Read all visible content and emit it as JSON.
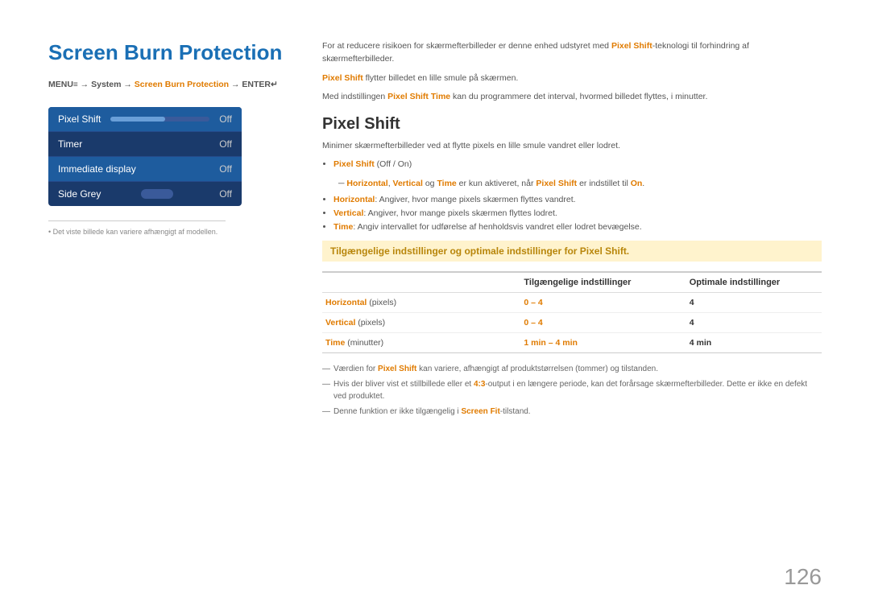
{
  "page": {
    "title": "Screen Burn Protection",
    "page_number": "126",
    "menu_path": {
      "prefix": "MENU",
      "menu_symbol": "≡",
      "path1": " → System → ",
      "highlight": "Screen Burn Protection",
      "path2": " → ENTER"
    },
    "intro": {
      "line1": "For at reducere risikoen for skærmefterbilleder er denne enhed udstyret med ",
      "bold1": "Pixel Shift",
      "line1b": "-teknologi til forhindring af skærmefterbilleder.",
      "line2_bold": "Pixel Shift",
      "line2": " flytter billedet en lille smule på skærmen.",
      "line3": "Med indstillingen ",
      "line3_bold": "Pixel Shift Time",
      "line3b": " kan du programmere det interval, hvormed billedet flyttes, i minutter."
    },
    "pixel_shift_section": {
      "title": "Pixel Shift",
      "body": "Minimer skærmefterbilleder ved at flytte pixels en lille smule vandret eller lodret.",
      "bullets": [
        {
          "text_bold": "Pixel Shift",
          "text": " (Off / On)"
        }
      ],
      "sub_note": "Horizontal, Vertical og Time er kun aktiveret, når Pixel Shift er indstillet til On.",
      "bullets2": [
        {
          "bold": "Horizontal",
          "text": ": Angiver, hvor mange pixels skærmen flyttes vandret."
        },
        {
          "bold": "Vertical",
          "text": ": Angiver, hvor mange pixels skærmen flyttes lodret."
        },
        {
          "bold": "Time",
          "text": ": Angiv intervallet for udførelse af henholdsvis vandret eller lodret bevægelse."
        }
      ]
    },
    "highlight_text": "Tilgængelige indstillinger og optimale indstillinger for Pixel Shift.",
    "table": {
      "headers": [
        "",
        "Tilgængelige indstillinger",
        "Optimale indstillinger"
      ],
      "rows": [
        {
          "label_bold": "Horizontal",
          "label_rest": " (pixels)",
          "col2": "0 – 4",
          "col3": "4"
        },
        {
          "label_bold": "Vertical",
          "label_rest": " (pixels)",
          "col2": "0 – 4",
          "col3": "4"
        },
        {
          "label_bold": "Time",
          "label_rest": " (minutter)",
          "col2": "1 min – 4 min",
          "col3": "4 min"
        }
      ]
    },
    "footnotes": [
      {
        "bold": "Pixel Shift",
        "text": " kan variere, afhængigt af produktstørrelsen (tommer) og tilstanden."
      },
      {
        "text": "Hvis der bliver vist et stillbillede eller et ",
        "bold": "4:3",
        "text2": "-output i en længere periode, kan det forårsage skærmefterbilleder. Dette er ikke en defekt ved produktet."
      },
      {
        "text": "Denne funktion er ikke tilgængelig i ",
        "bold": "Screen Fit",
        "text2": "-tilstand."
      }
    ],
    "menu_items": [
      {
        "label": "Pixel Shift",
        "type": "slider",
        "value": "Off"
      },
      {
        "label": "Timer",
        "type": "value",
        "value": "Off"
      },
      {
        "label": "Immediate display",
        "type": "value",
        "value": "Off"
      },
      {
        "label": "Side Grey",
        "type": "slider_small",
        "value": "Off"
      }
    ],
    "image_note": "Det viste billede kan variere afhængigt af modellen."
  }
}
